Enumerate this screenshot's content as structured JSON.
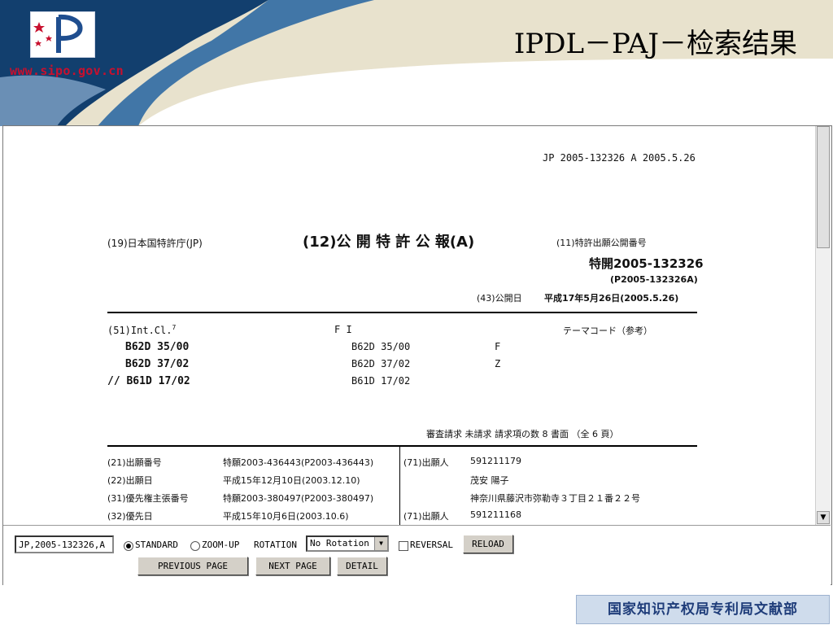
{
  "header": {
    "website": "www.sipo.gov.cn",
    "title": "IPDL－PAJ－检索结果",
    "colors": {
      "band_dark": "#123f6e",
      "band_light": "#7a9ec2",
      "beige": "#e8e2cd",
      "url_red": "#c8102e"
    }
  },
  "document": {
    "top_ref": "JP  2005-132326  A  2005.5.26",
    "office": "(19)日本国特許庁(JP)",
    "pub_type": "(12)公 開 特 許 公 報(A)",
    "pub_no_label": "(11)特許出願公開番号",
    "pub_no": "特開2005-132326",
    "pub_no_alt": "(P2005-132326A)",
    "pub_date_label": "(43)公開日",
    "pub_date": "平成17年5月26日(2005.5.26)",
    "intcl_label": "(51)Int.Cl.",
    "intcl_sup": "7",
    "fi_label": "F I",
    "theme_label": "テーマコード（参考）",
    "intcl_rows": [
      {
        "left": "B62D  35/00",
        "fi": "B62D  35/00",
        "code": "F"
      },
      {
        "left": "B62D  37/02",
        "fi": "B62D  37/02",
        "code": "Z"
      },
      {
        "left": "// B61D  17/02",
        "fi": "B61D  17/02",
        "code": ""
      }
    ],
    "exam_line": "審査請求 未請求  請求項の数 8  書面  （全 6 頁）",
    "left_rows": [
      {
        "label": "(21)出願番号",
        "value": "特願2003-436443(P2003-436443)"
      },
      {
        "label": "(22)出願日",
        "value": "平成15年12月10日(2003.12.10)"
      },
      {
        "label": "(31)優先権主張番号",
        "value": "特願2003-380497(P2003-380497)"
      },
      {
        "label": "(32)優先日",
        "value": "平成15年10月6日(2003.10.6)"
      }
    ],
    "right_rows": [
      {
        "label": "(71)出願人",
        "value": "591211179"
      },
      {
        "label": "",
        "value": "茂安 陽子"
      },
      {
        "label": "",
        "value": "神奈川県藤沢市弥勒寺３丁目２１番２２号"
      },
      {
        "label": "(71)出願人",
        "value": "591211168"
      }
    ]
  },
  "controls": {
    "doc_number_value": "JP,2005-132326,A",
    "standard_label": "STANDARD",
    "zoom_label": "ZOOM-UP",
    "rotation_label": "ROTATION",
    "rotation_value": "No Rotation",
    "reversal_label": "REVERSAL",
    "reload_label": "RELOAD",
    "prev_label": "PREVIOUS PAGE",
    "next_label": "NEXT PAGE",
    "detail_label": "DETAIL"
  },
  "footer": {
    "text": "国家知识产权局专利局文献部"
  }
}
